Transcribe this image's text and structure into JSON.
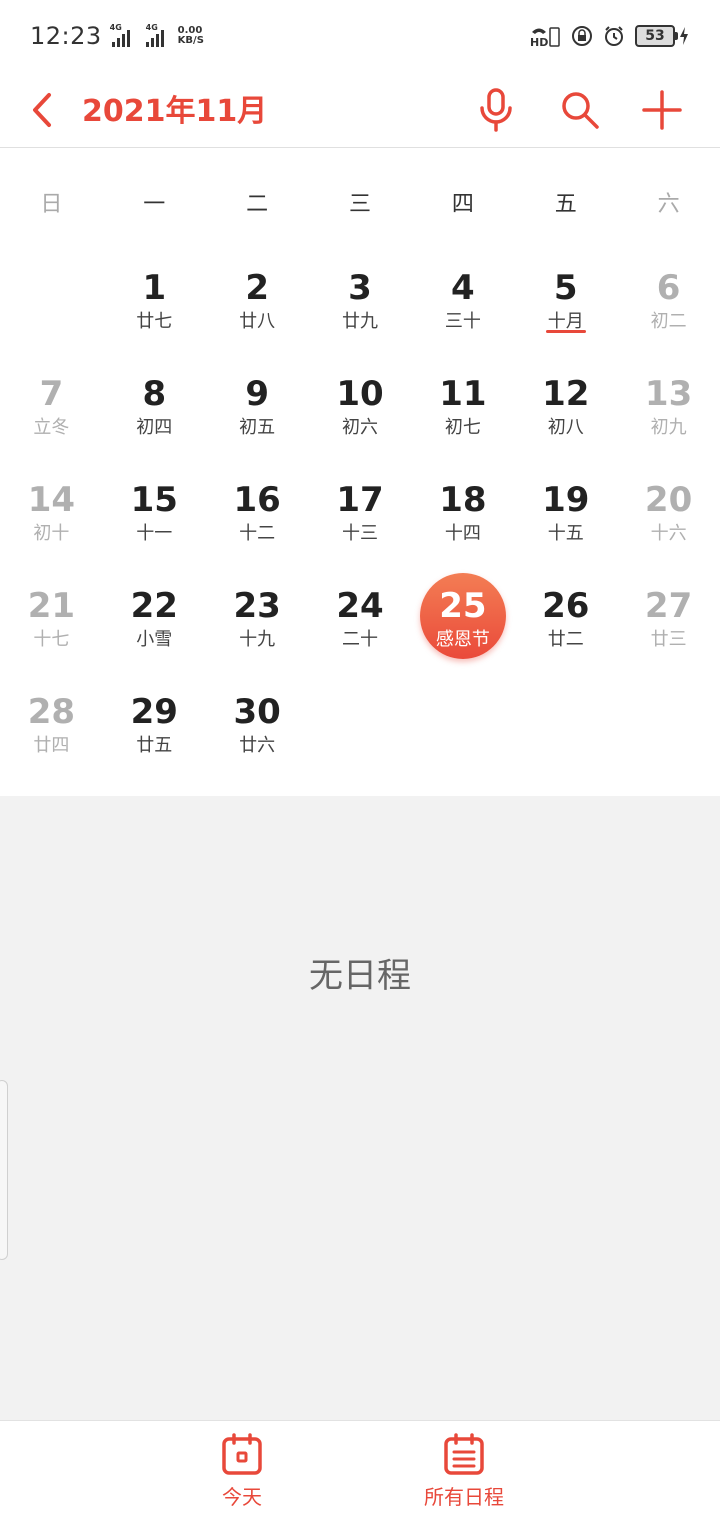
{
  "status": {
    "time": "12:23",
    "net1": "4G",
    "net2": "4G",
    "speed_value": "0.00",
    "speed_unit": "KB/S",
    "battery": "53"
  },
  "header": {
    "title": "2021年11月"
  },
  "weekdays": [
    "日",
    "一",
    "二",
    "三",
    "四",
    "五",
    "六"
  ],
  "calendar": {
    "rows": [
      [
        {
          "day": "",
          "lunar": ""
        },
        {
          "day": "1",
          "lunar": "廿七"
        },
        {
          "day": "2",
          "lunar": "廿八"
        },
        {
          "day": "3",
          "lunar": "廿九"
        },
        {
          "day": "4",
          "lunar": "三十"
        },
        {
          "day": "5",
          "lunar": "十月"
        },
        {
          "day": "6",
          "lunar": "初二"
        }
      ],
      [
        {
          "day": "7",
          "lunar": "立冬"
        },
        {
          "day": "8",
          "lunar": "初四"
        },
        {
          "day": "9",
          "lunar": "初五"
        },
        {
          "day": "10",
          "lunar": "初六"
        },
        {
          "day": "11",
          "lunar": "初七"
        },
        {
          "day": "12",
          "lunar": "初八"
        },
        {
          "day": "13",
          "lunar": "初九"
        }
      ],
      [
        {
          "day": "14",
          "lunar": "初十"
        },
        {
          "day": "15",
          "lunar": "十一"
        },
        {
          "day": "16",
          "lunar": "十二"
        },
        {
          "day": "17",
          "lunar": "十三"
        },
        {
          "day": "18",
          "lunar": "十四"
        },
        {
          "day": "19",
          "lunar": "十五"
        },
        {
          "day": "20",
          "lunar": "十六"
        }
      ],
      [
        {
          "day": "21",
          "lunar": "十七"
        },
        {
          "day": "22",
          "lunar": "小雪"
        },
        {
          "day": "23",
          "lunar": "十九"
        },
        {
          "day": "24",
          "lunar": "二十"
        },
        {
          "day": "25",
          "lunar": "感恩节"
        },
        {
          "day": "26",
          "lunar": "廿二"
        },
        {
          "day": "27",
          "lunar": "廿三"
        }
      ],
      [
        {
          "day": "28",
          "lunar": "廿四"
        },
        {
          "day": "29",
          "lunar": "廿五"
        },
        {
          "day": "30",
          "lunar": "廿六"
        },
        {
          "day": "",
          "lunar": ""
        },
        {
          "day": "",
          "lunar": ""
        },
        {
          "day": "",
          "lunar": ""
        },
        {
          "day": "",
          "lunar": ""
        }
      ]
    ],
    "today_day": "5",
    "selected_day": "25"
  },
  "schedule": {
    "empty_text": "无日程"
  },
  "bottom_nav": {
    "today_label": "今天",
    "all_label": "所有日程"
  },
  "colors": {
    "accent": "#e8483a"
  }
}
